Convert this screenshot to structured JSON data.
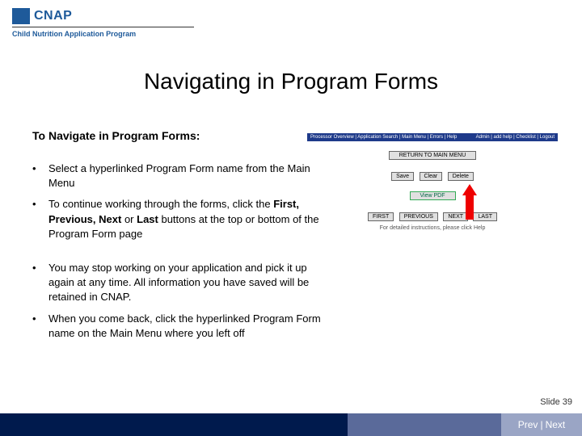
{
  "logo": {
    "brand": "CNAP",
    "subtitle": "Child Nutrition Application Program"
  },
  "title": "Navigating in Program Forms",
  "section_heading": "To Navigate in Program Forms:",
  "bullets": [
    {
      "text": "Select a hyperlinked Program Form name from the Main Menu"
    },
    {
      "text_html": "To continue working through the forms, click the <b>First, Previous, Next</b> or <b>Last</b> buttons at the top or bottom of the Program Form page"
    },
    {
      "text": "You may stop working on your application and pick it up again at any time.  All information you have saved will be retained in CNAP."
    },
    {
      "text": "When you come back, click the hyperlinked Program Form name on the Main Menu where you left off"
    }
  ],
  "mock": {
    "nav_left": "Processor Overview | Application Search | Main Menu | Errors | Help",
    "nav_right": "Admin | add help | Checklist | Logout",
    "return_btn": "RETURN TO MAIN MENU",
    "row1": [
      "Save",
      "Clear",
      "Delete"
    ],
    "pdf_btn": "View PDF",
    "row2": [
      "FIRST",
      "PREVIOUS",
      "NEXT",
      "LAST"
    ],
    "help_text": "For detailed instructions, please click Help"
  },
  "slide_number": "Slide 39",
  "footer": {
    "prev": "Prev",
    "next": "Next",
    "sep": "|"
  }
}
